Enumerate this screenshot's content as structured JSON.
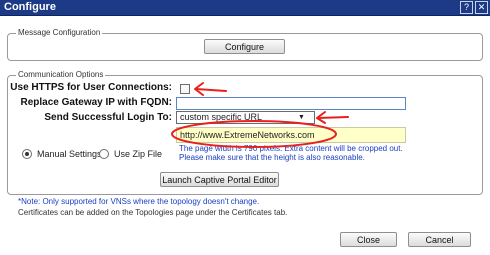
{
  "window": {
    "title": "Configure",
    "help_glyph": "?",
    "close_glyph": "✕"
  },
  "message_configuration": {
    "legend": "Message Configuration",
    "configure_button": "Configure"
  },
  "communication_options": {
    "legend": "Communication Options",
    "use_https_label": "Use HTTPS for User Connections:",
    "use_https_checked": false,
    "replace_gateway_label": "Replace Gateway IP with FQDN:",
    "replace_gateway_value": "",
    "send_login_label": "Send Successful Login To:",
    "send_login_selected": "custom specific URL",
    "url_value": "http://www.ExtremeNetworks.com",
    "page_width_note_1": "The page width is 790 pixels. Extra content will be cropped out.",
    "page_width_note_2": "Please make sure that the height is also reasonable.",
    "radio_manual_label": "Manual Settings",
    "radio_zip_label": "Use Zip File",
    "selected_radio": "Manual Settings",
    "launch_button": "Launch Captive Portal Editor"
  },
  "footer": {
    "note_1": "*Note: Only supported for VNSs where the topology doesn't change.",
    "note_2": "Certificates can be added on the Topologies page under the Certificates tab.",
    "close_button": "Close",
    "cancel_button": "Cancel"
  },
  "colors": {
    "titlebar": "#1d3a86",
    "annotation_red": "#e8201e",
    "link_blue": "#1a3fbf",
    "url_highlight": "#ffffc8"
  }
}
